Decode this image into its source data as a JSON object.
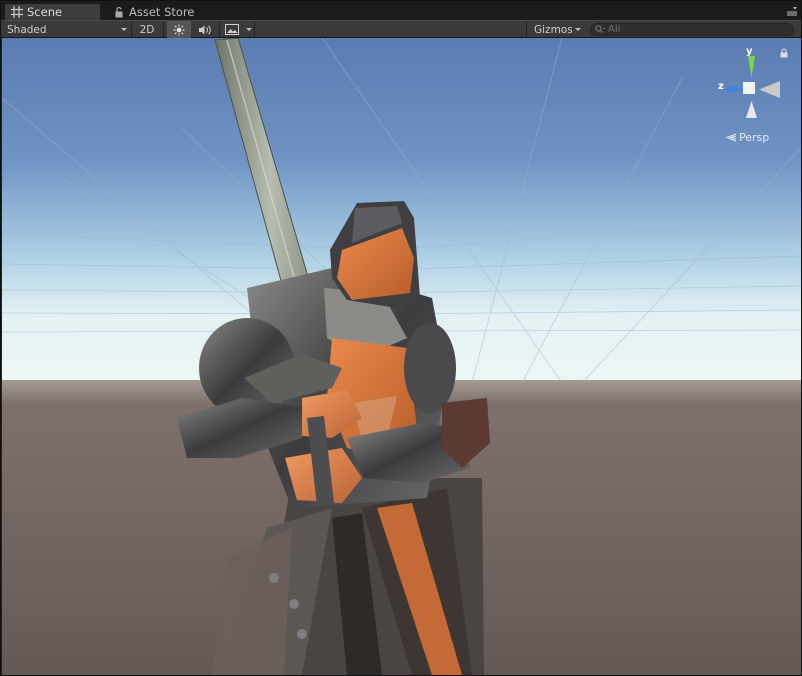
{
  "tabs": [
    {
      "label": "Scene",
      "icon": "scene-grid-icon",
      "active": true
    },
    {
      "label": "Asset Store",
      "icon": "lock-icon",
      "active": false
    }
  ],
  "toolbar": {
    "shading_mode": "Shaded",
    "btn_2d": "2D",
    "gizmos_label": "Gizmos",
    "search_placeholder": "All"
  },
  "gizmo": {
    "y_label": "y",
    "z_label": "z",
    "projection_label": "Persp"
  },
  "colors": {
    "sky_top": "#5d7fb2",
    "sky_horizon": "#d9ecf2",
    "ground": "#6f625e",
    "y_axis": "#7fd44a",
    "z_axis": "#3d82e8"
  }
}
